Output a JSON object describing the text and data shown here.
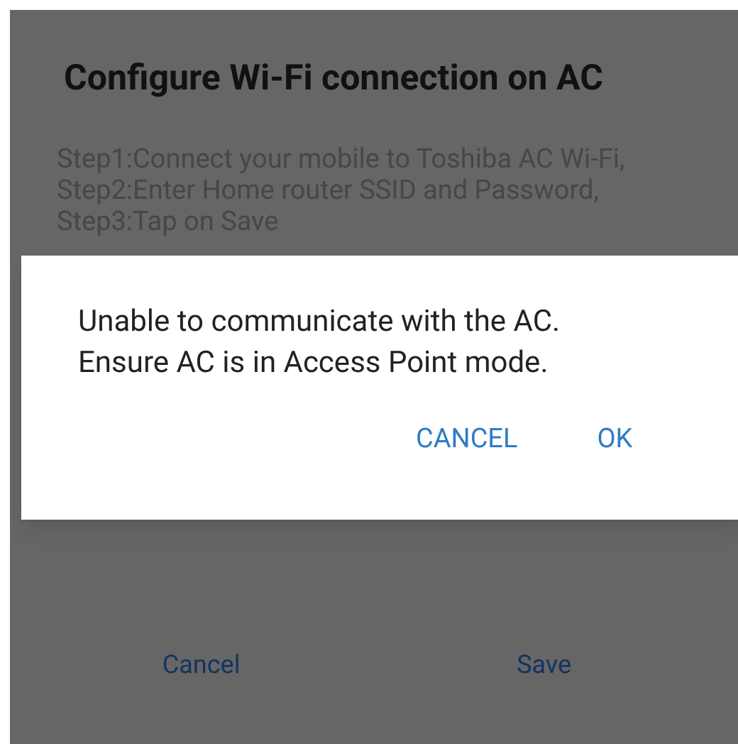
{
  "screen": {
    "title": "Configure Wi-Fi connection on AC",
    "steps": [
      "Step1:Connect your mobile to Toshiba AC Wi-Fi,",
      "Step2:Enter Home router SSID and Password,",
      "Step3:Tap on Save"
    ],
    "buttons": [
      {
        "label": "Cancel"
      },
      {
        "label": "Save"
      }
    ]
  },
  "dialog": {
    "message": [
      "Unable to communicate with the AC.",
      "Ensure AC is in Access Point mode."
    ],
    "buttons": [
      {
        "label": "CANCEL"
      },
      {
        "label": "OK"
      }
    ]
  }
}
